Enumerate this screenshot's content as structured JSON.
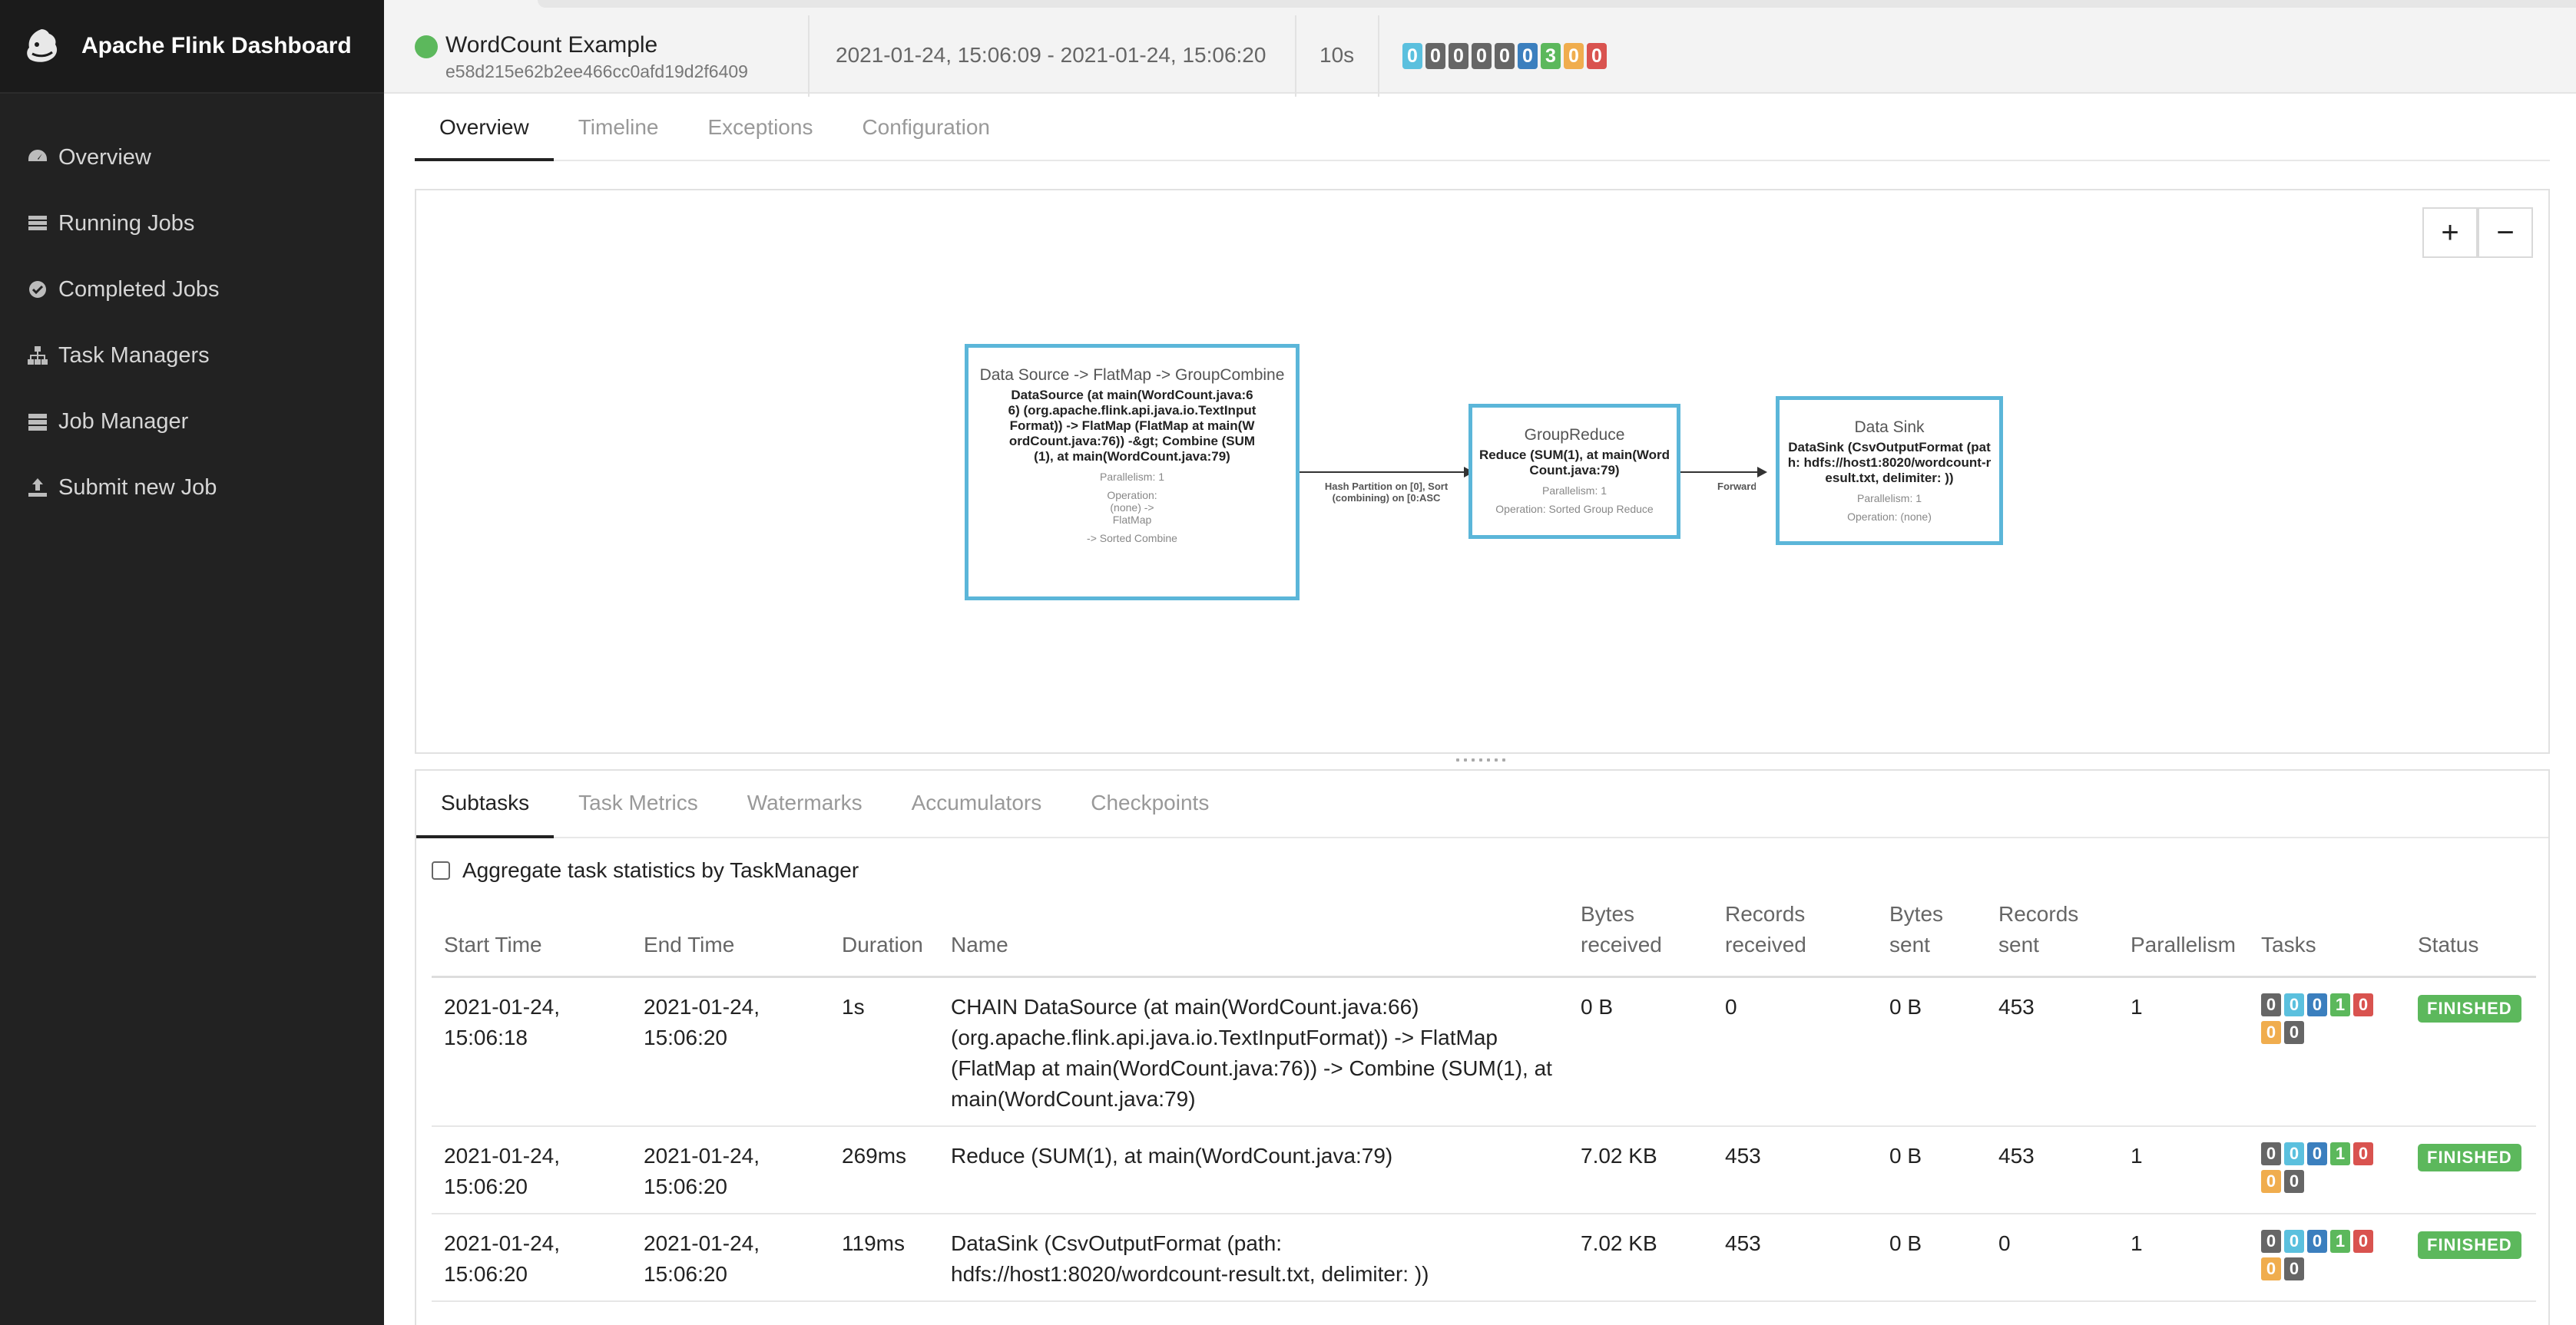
{
  "app": {
    "title": "Apache Flink Dashboard"
  },
  "sidebar": {
    "items": [
      {
        "label": "Overview",
        "icon": "dashboard-icon"
      },
      {
        "label": "Running Jobs",
        "icon": "tasks-icon"
      },
      {
        "label": "Completed Jobs",
        "icon": "check-circle-icon"
      },
      {
        "label": "Task Managers",
        "icon": "sitemap-icon"
      },
      {
        "label": "Job Manager",
        "icon": "server-icon"
      },
      {
        "label": "Submit new Job",
        "icon": "upload-icon"
      }
    ]
  },
  "job": {
    "name": "WordCount Example",
    "id": "e58d215e62b2ee466cc0afd19d2f6409",
    "time_range": "2021-01-24, 15:06:09 - 2021-01-24, 15:06:20",
    "duration": "10s",
    "task_counts": [
      {
        "value": "0",
        "color": "#5bc0de"
      },
      {
        "value": "0",
        "color": "#666666"
      },
      {
        "value": "0",
        "color": "#666666"
      },
      {
        "value": "0",
        "color": "#666666"
      },
      {
        "value": "0",
        "color": "#666666"
      },
      {
        "value": "0",
        "color": "#3b7fbe"
      },
      {
        "value": "3",
        "color": "#5cb85c"
      },
      {
        "value": "0",
        "color": "#f0ad4e"
      },
      {
        "value": "0",
        "color": "#d9534f"
      }
    ]
  },
  "tabs": [
    "Overview",
    "Timeline",
    "Exceptions",
    "Configuration"
  ],
  "graph": {
    "zoom_in": "+",
    "zoom_out": "−",
    "nodes": [
      {
        "title": "Data Source -> FlatMap -> GroupCombine",
        "description": "DataSource (at main(WordCount.java:66) (org.apache.flink.api.java.io.TextInputFormat)) -> FlatMap (FlatMap at main(WordCount.java:76)) -&gt; Combine (SUM(1), at main(WordCount.java:79)",
        "meta": [
          "Parallelism: 1",
          "Operation: (none) -> FlatMap",
          "-> Sorted Combine"
        ]
      },
      {
        "title": "GroupReduce",
        "description": "Reduce (SUM(1), at main(WordCount.java:79)",
        "meta": [
          "Parallelism: 1",
          "Operation: Sorted Group Reduce"
        ]
      },
      {
        "title": "Data Sink",
        "description": "DataSink (CsvOutputFormat (path: hdfs://host1:8020/wordcount-result.txt, delimiter: ))",
        "meta": [
          "Parallelism: 1",
          "Operation: (none)"
        ]
      }
    ],
    "edges": [
      {
        "label": "Hash Partition on [0], Sort (combining) on [0:ASC"
      },
      {
        "label": "Forward"
      }
    ]
  },
  "subtabs": [
    "Subtasks",
    "Task Metrics",
    "Watermarks",
    "Accumulators",
    "Checkpoints"
  ],
  "aggregate_label": "Aggregate task statistics by TaskManager",
  "table": {
    "columns": [
      "Start Time",
      "End Time",
      "Duration",
      "Name",
      "Bytes received",
      "Records received",
      "Bytes sent",
      "Records sent",
      "Parallelism",
      "Tasks",
      "Status"
    ],
    "rows": [
      {
        "start": "2021-01-24, 15:06:18",
        "end": "2021-01-24, 15:06:20",
        "duration": "1s",
        "name": "CHAIN DataSource (at main(WordCount.java:66) (org.apache.flink.api.java.io.TextInputFormat)) -> FlatMap (FlatMap at main(WordCount.java:76)) -> Combine (SUM(1), at main(WordCount.java:79)",
        "bytes_received": "0 B",
        "records_received": "0",
        "bytes_sent": "0 B",
        "records_sent": "453",
        "parallelism": "1",
        "status": "FINISHED"
      },
      {
        "start": "2021-01-24, 15:06:20",
        "end": "2021-01-24, 15:06:20",
        "duration": "269ms",
        "name": "Reduce (SUM(1), at main(WordCount.java:79)",
        "bytes_received": "7.02 KB",
        "records_received": "453",
        "bytes_sent": "0 B",
        "records_sent": "453",
        "parallelism": "1",
        "status": "FINISHED"
      },
      {
        "start": "2021-01-24, 15:06:20",
        "end": "2021-01-24, 15:06:20",
        "duration": "119ms",
        "name": "DataSink (CsvOutputFormat (path: hdfs://host1:8020/wordcount-result.txt, delimiter:  ))",
        "bytes_received": "7.02 KB",
        "records_received": "453",
        "bytes_sent": "0 B",
        "records_sent": "0",
        "parallelism": "1",
        "status": "FINISHED"
      }
    ],
    "task_badges": [
      {
        "value": "0",
        "color": "#666666"
      },
      {
        "value": "0",
        "color": "#5bc0de"
      },
      {
        "value": "0",
        "color": "#3b7fbe"
      },
      {
        "value": "1",
        "color": "#5cb85c"
      },
      {
        "value": "0",
        "color": "#d9534f"
      },
      {
        "value": "0",
        "color": "#f0ad4e"
      },
      {
        "value": "0",
        "color": "#666666"
      }
    ]
  }
}
